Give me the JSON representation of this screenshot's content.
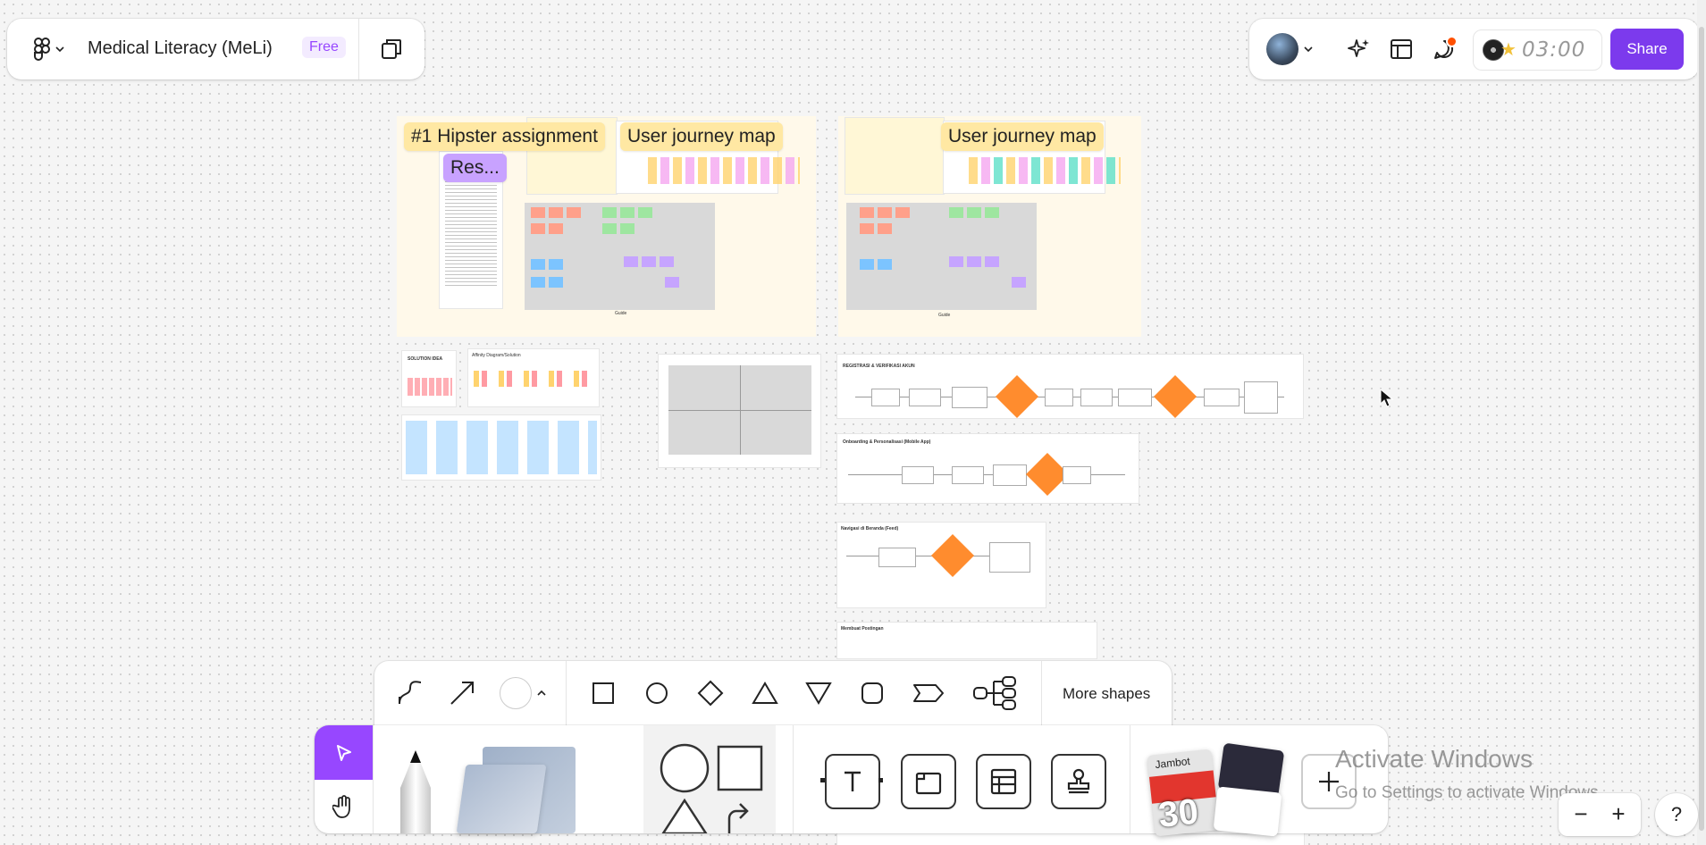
{
  "file": {
    "title": "Medical Literacy (MeLi)",
    "plan_badge": "Free"
  },
  "header": {
    "timer": "03:00",
    "share_label": "Share"
  },
  "canvas": {
    "board1_tag1": "#1 Hipster assignment",
    "board1_tag2": "Res...",
    "board1_tag3": "User journey map",
    "board2_tag1": "User journey map",
    "labels": {
      "solution_idea": "SOLUTION IDEA",
      "affinity": "Affinity Diagram/Solution",
      "registrasi": "REGISTRASI & VERIFIKASI AKUN",
      "onboarding": "Onboarding & Personalisasi (Mobile App)",
      "navigasi": "Navigasi di Beranda (Feed)",
      "membuat": "Membuat Postingan",
      "guide": "Guide"
    }
  },
  "shapes_toolbar": {
    "more_shapes_label": "More shapes",
    "tools": [
      "connector-icon",
      "arrow-icon",
      "color-swatch",
      "rectangle-icon",
      "ellipse-icon",
      "diamond-icon",
      "triangle-icon",
      "triangle-down-icon",
      "rounded-rect-icon",
      "chevron-shape-icon",
      "mindmap-icon"
    ]
  },
  "main_toolbar": {
    "tools": [
      "move-tool",
      "hand-tool",
      "pencil-tool",
      "sticky-tool",
      "shapes-tool",
      "text-tool",
      "section-tool",
      "table-tool",
      "stamp-tool",
      "widgets-tool",
      "add-tool"
    ],
    "widget_card_label": "Jambot",
    "widget_number": "30"
  },
  "watermark": {
    "line1": "Activate Windows",
    "line2": "Go to Settings to activate Windows."
  },
  "zoom": {
    "minus": "−",
    "plus": "+",
    "help": "?"
  },
  "colors": {
    "accent": "#9747ff",
    "share": "#7c3aed",
    "notification": "#ff4f00",
    "diamond": "#ff8c2e"
  }
}
